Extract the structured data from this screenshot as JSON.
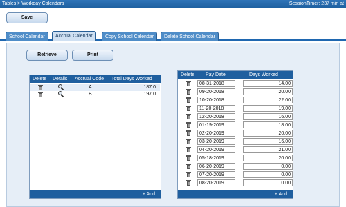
{
  "topbar": {
    "breadcrumb": "Tables > Workday Calendars",
    "session_timer": "SessionTimer: 237 min at"
  },
  "toolbar": {
    "save_label": "Save"
  },
  "tabs": [
    {
      "label": "School Calendar"
    },
    {
      "label": "Accrual Calendar",
      "active": true
    },
    {
      "label": "Copy School Calendar"
    },
    {
      "label": "Delete School Calendar"
    }
  ],
  "actions": {
    "retrieve_label": "Retrieve",
    "print_label": "Print"
  },
  "accrual_grid": {
    "headers": {
      "delete": "Delete",
      "details": "Details",
      "code": "Accrual Code",
      "total": "Total Days Worked"
    },
    "rows": [
      {
        "code": "A",
        "total": "187.0"
      },
      {
        "code": "B",
        "total": "197.0"
      }
    ],
    "add_label": "+ Add"
  },
  "pay_grid": {
    "headers": {
      "delete": "Delete",
      "pay_date": "Pay Date",
      "days": "Days Worked"
    },
    "rows": [
      {
        "date": "08-31-2018",
        "days": "14.00"
      },
      {
        "date": "09-20-2018",
        "days": "20.00"
      },
      {
        "date": "10-20-2018",
        "days": "22.00"
      },
      {
        "date": "11-20-2018",
        "days": "19.00"
      },
      {
        "date": "12-20-2018",
        "days": "16.00"
      },
      {
        "date": "01-19-2019",
        "days": "18.00"
      },
      {
        "date": "02-20-2019",
        "days": "20.00"
      },
      {
        "date": "03-20-2019",
        "days": "16.00"
      },
      {
        "date": "04-20-2019",
        "days": "21.00"
      },
      {
        "date": "05-18-2019",
        "days": "20.00"
      },
      {
        "date": "06-20-2019",
        "days": "0.00"
      },
      {
        "date": "07-20-2019",
        "days": "0.00"
      },
      {
        "date": "08-20-2019",
        "days": "0.00"
      }
    ],
    "add_label": "+ Add"
  }
}
